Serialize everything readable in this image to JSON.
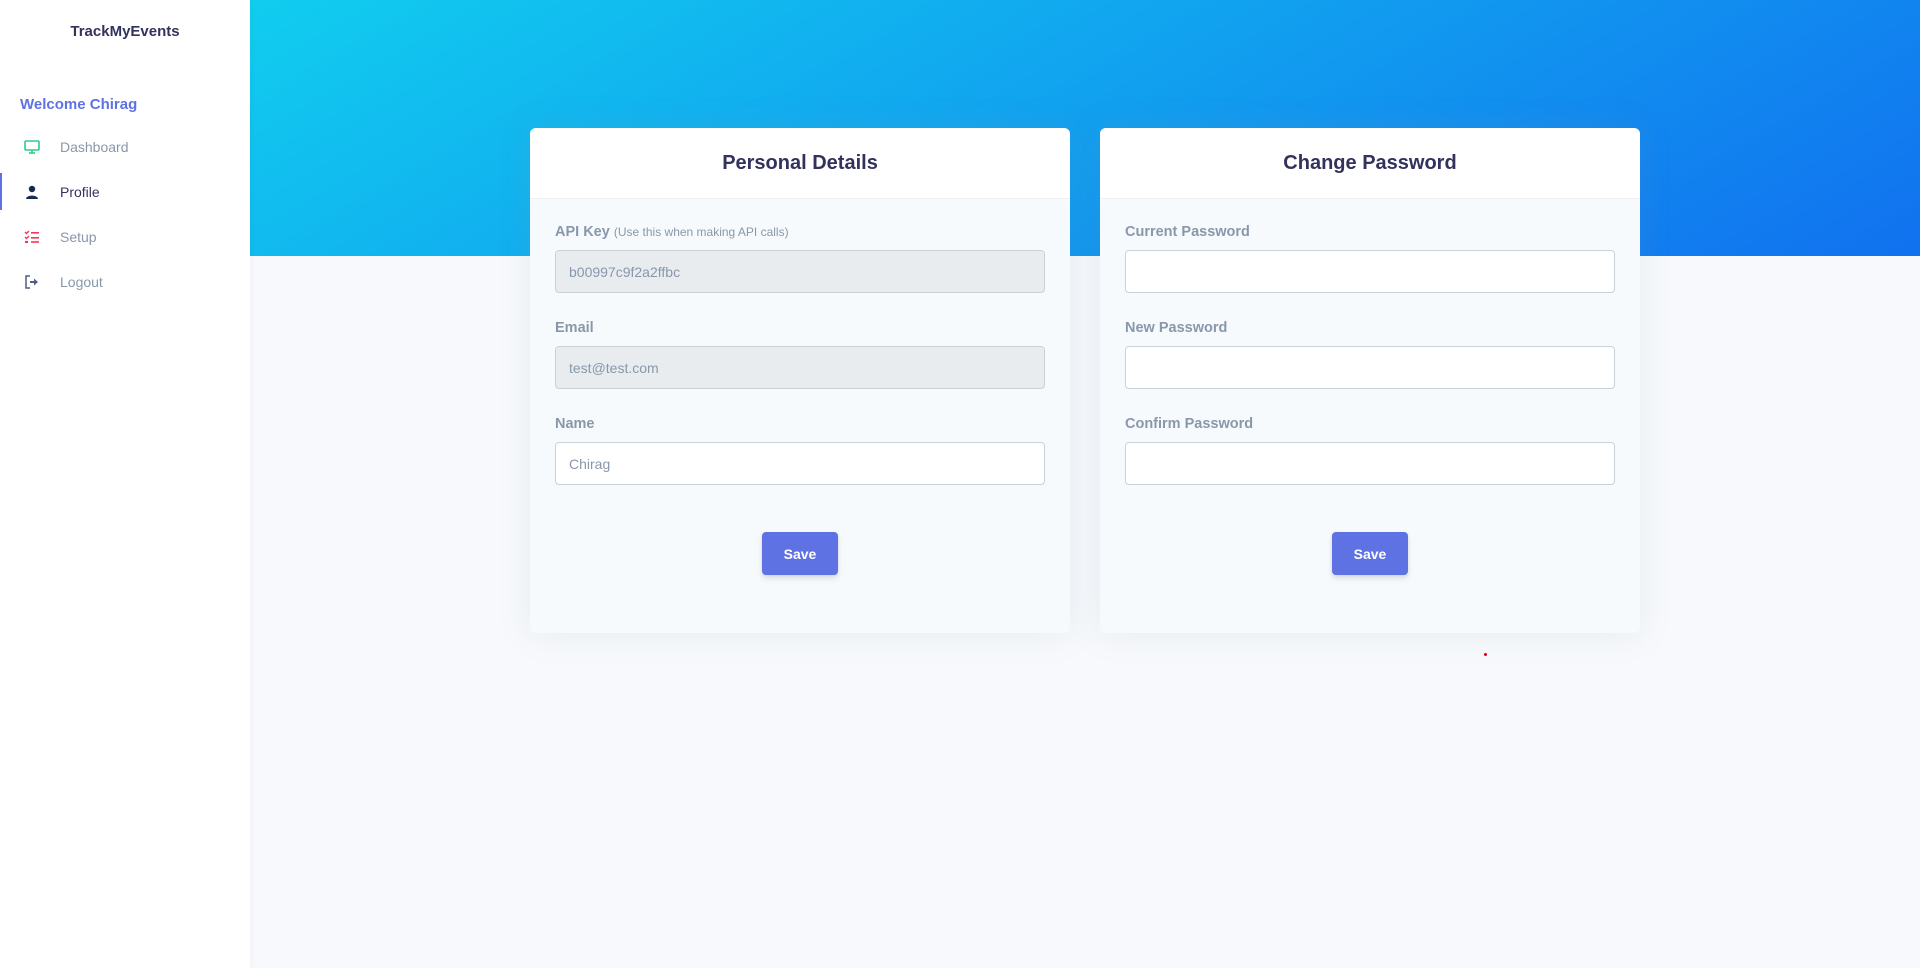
{
  "brand": {
    "title": "TrackMyEvents"
  },
  "sidebar": {
    "welcome": "Welcome Chirag",
    "items": [
      {
        "label": "Dashboard",
        "icon": "monitor-icon",
        "color": "#2dce89"
      },
      {
        "label": "Profile",
        "icon": "user-icon",
        "color": "#172b4d",
        "active": true
      },
      {
        "label": "Setup",
        "icon": "checklist-icon",
        "color": "#f5365c"
      },
      {
        "label": "Logout",
        "icon": "logout-icon",
        "color": "#525f7f"
      }
    ]
  },
  "personal": {
    "title": "Personal Details",
    "api_key_label": "API Key",
    "api_key_hint": "(Use this when making API calls)",
    "api_key_value": "b00997c9f2a2ffbc",
    "email_label": "Email",
    "email_value": "test@test.com",
    "name_label": "Name",
    "name_value": "Chirag",
    "save_label": "Save"
  },
  "password": {
    "title": "Change Password",
    "current_label": "Current Password",
    "new_label": "New Password",
    "confirm_label": "Confirm Password",
    "save_label": "Save"
  },
  "colors": {
    "accent": "#5e72e4",
    "banner_start": "#11cdef",
    "banner_end": "#1171ef"
  }
}
